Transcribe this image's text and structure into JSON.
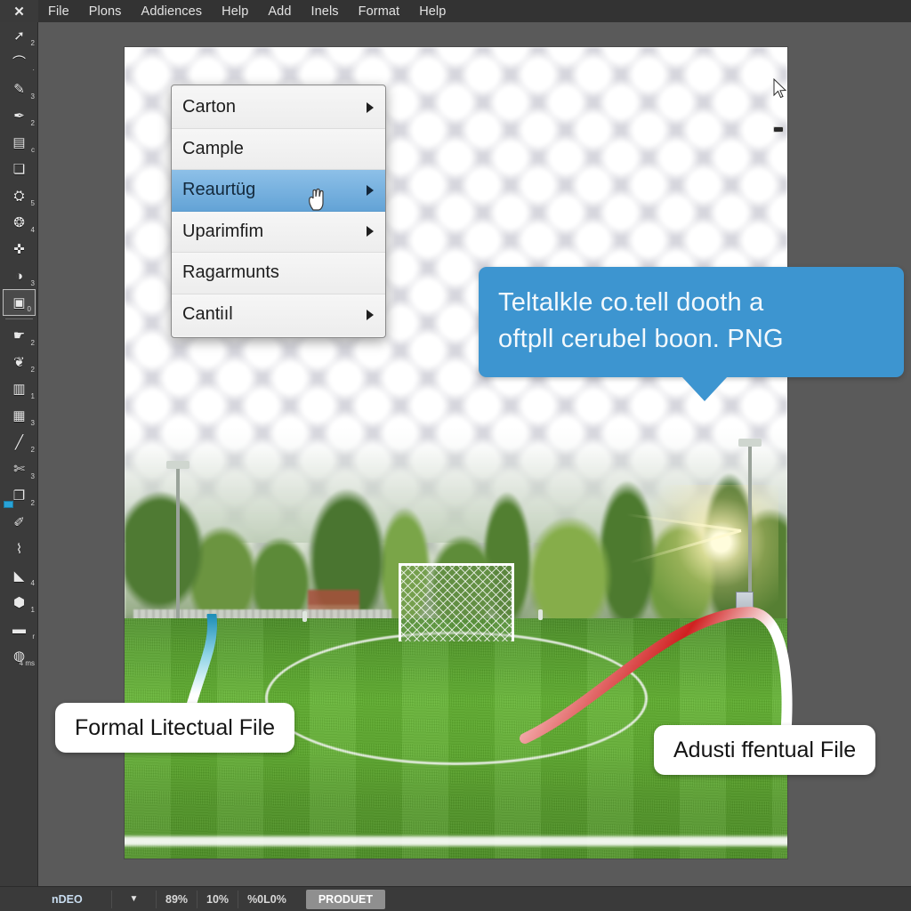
{
  "window": {
    "close_label": "✕",
    "background_color": "#5a5a5a"
  },
  "menubar": {
    "items": [
      {
        "label": "File"
      },
      {
        "label": "Plons"
      },
      {
        "label": "Addiences"
      },
      {
        "label": "Help"
      },
      {
        "label": "Add"
      },
      {
        "label": "Inels"
      },
      {
        "label": "Format"
      },
      {
        "label": "Help"
      }
    ]
  },
  "toolbar": {
    "tools": [
      {
        "icon": "pointer-icon",
        "glyph": "➚",
        "badge": "2"
      },
      {
        "icon": "lasso-icon",
        "glyph": "⌒",
        "badge": "·"
      },
      {
        "icon": "pen-icon",
        "glyph": "✎",
        "badge": "3"
      },
      {
        "icon": "quill-icon",
        "glyph": "✒",
        "badge": "2"
      },
      {
        "icon": "save-icon",
        "glyph": "▤",
        "badge": "c"
      },
      {
        "icon": "copy-icon",
        "glyph": "❏",
        "badge": ""
      },
      {
        "icon": "stamp-icon",
        "glyph": "⛭",
        "badge": "5"
      },
      {
        "icon": "clone-icon",
        "glyph": "❂",
        "badge": "4"
      },
      {
        "icon": "puzzle-icon",
        "glyph": "✜",
        "badge": ""
      },
      {
        "icon": "contrast-icon",
        "glyph": "◑",
        "badge": "3"
      },
      {
        "icon": "crop-icon",
        "glyph": "▣",
        "badge": "0",
        "selected": true
      },
      {
        "icon": "hand-icon",
        "glyph": "☛",
        "badge": "2"
      },
      {
        "icon": "brain-icon",
        "glyph": "❦",
        "badge": "2"
      },
      {
        "icon": "bucket-icon",
        "glyph": "▥",
        "badge": "1"
      },
      {
        "icon": "grid-icon",
        "glyph": "▦",
        "badge": "3"
      },
      {
        "icon": "line-icon",
        "glyph": "╱",
        "badge": "2"
      },
      {
        "icon": "scissors-icon",
        "glyph": "✄",
        "badge": "3"
      },
      {
        "icon": "layers-icon",
        "glyph": "❐",
        "badge": "2",
        "swatch": true
      },
      {
        "icon": "pencil-icon",
        "glyph": "✐",
        "badge": ""
      },
      {
        "icon": "eyedropper-icon",
        "glyph": "⌇",
        "badge": ""
      },
      {
        "icon": "fill-icon",
        "glyph": "◣",
        "badge": "4"
      },
      {
        "icon": "blob-icon",
        "glyph": "⬢",
        "badge": "1"
      },
      {
        "icon": "gradient-icon",
        "glyph": "▬",
        "badge": "r"
      },
      {
        "icon": "globe-icon",
        "glyph": "◍",
        "badge": "4 ms"
      }
    ]
  },
  "context_menu": {
    "items": [
      {
        "label": "Carton",
        "submenu": true,
        "highlight": false
      },
      {
        "label": "Cample",
        "submenu": false,
        "highlight": false
      },
      {
        "label": "Reaurtüg",
        "submenu": true,
        "highlight": true
      },
      {
        "label": "Uparimfim",
        "submenu": true,
        "highlight": false
      },
      {
        "label": "Ragarmunts",
        "submenu": false,
        "highlight": false
      },
      {
        "label": "Cantiıl",
        "submenu": true,
        "highlight": false
      }
    ],
    "highlight_color": "#63a3d6"
  },
  "tooltip": {
    "line1": "Teltalkle co.tell dooth a",
    "line2": "oftpll cerubel boon. PNG",
    "color": "#3d95d0"
  },
  "callouts": {
    "left": {
      "label": "Formal Litectual File",
      "leader_color": "#2f9fc4"
    },
    "right": {
      "label": "Adusti ffentual File",
      "leader_color": "#cc1f1f"
    }
  },
  "canvas": {
    "image_description": "soccer-field-photo",
    "transparency_pattern": "checkerboard"
  },
  "statusbar": {
    "document": "nDEO",
    "dropdown": "▼",
    "zoom": "89%",
    "value2": "10%",
    "value3": "%0L0%",
    "product": "PRODUET"
  }
}
